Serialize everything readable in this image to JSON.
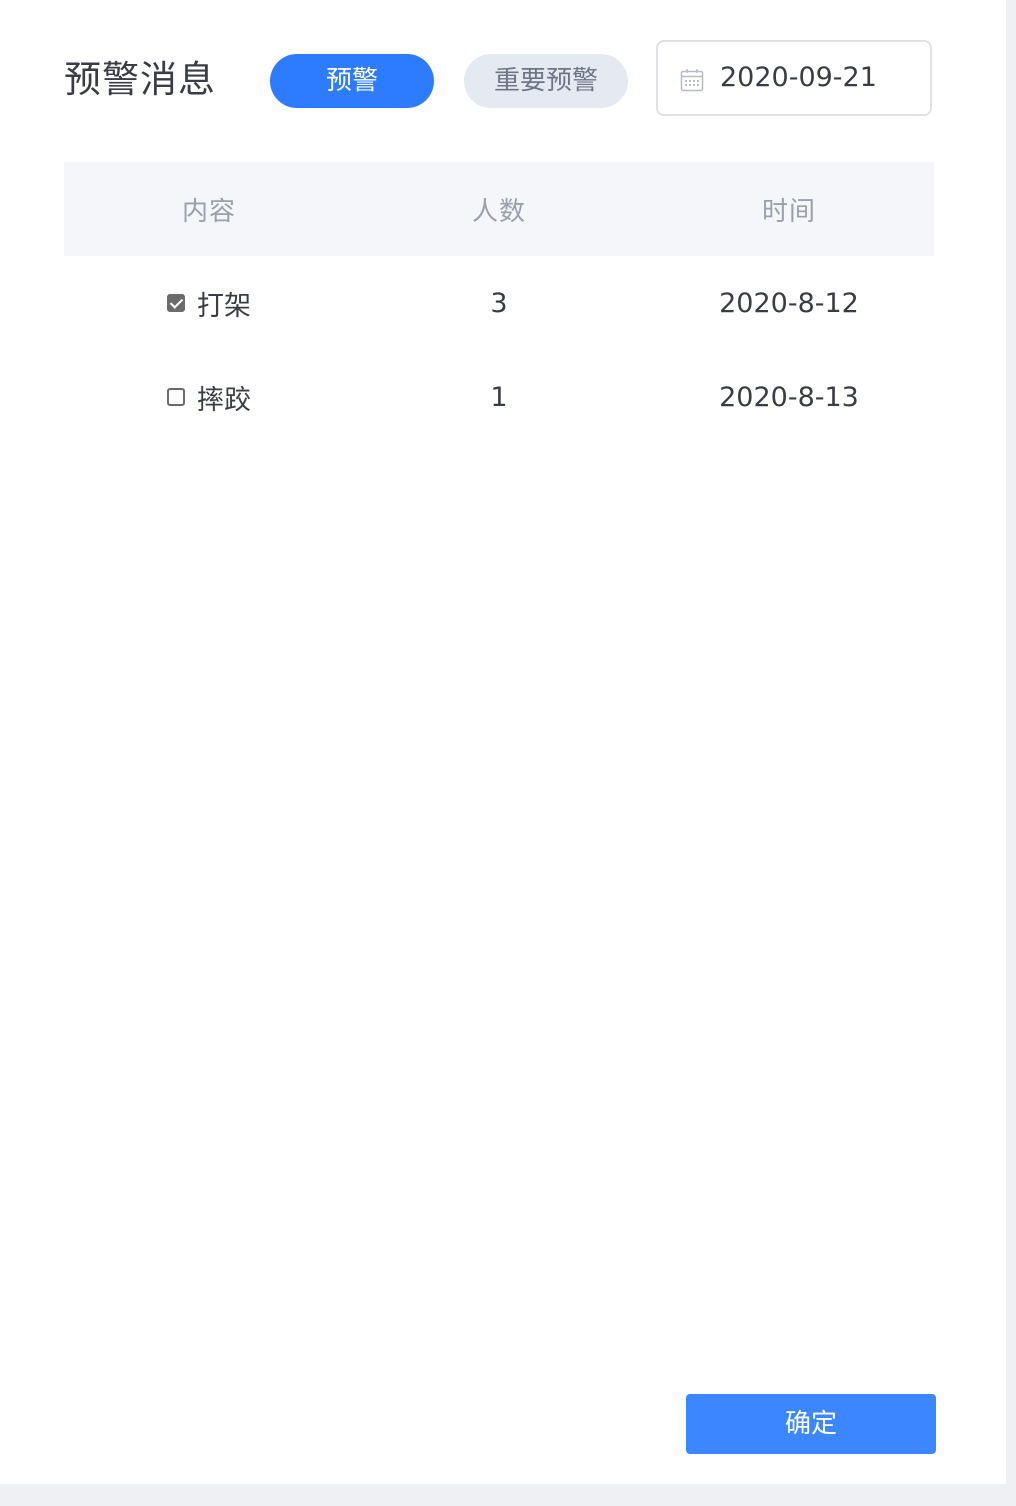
{
  "header": {
    "title": "预警消息",
    "tabs": [
      {
        "label": "预警",
        "active": true
      },
      {
        "label": "重要预警",
        "active": false
      }
    ],
    "date": {
      "value": "2020-09-21",
      "icon": "calendar-icon"
    }
  },
  "table": {
    "columns": [
      "内容",
      "人数",
      "时间"
    ],
    "rows": [
      {
        "checked": true,
        "content": "打架",
        "count": "3",
        "time": "2020-8-12"
      },
      {
        "checked": false,
        "content": "摔跤",
        "count": "1",
        "time": "2020-8-13"
      }
    ]
  },
  "footer": {
    "confirm_label": "确定"
  },
  "colors": {
    "primary": "#2d7bff",
    "button": "#3c86ff",
    "pill_inactive_bg": "#e5e9f1",
    "table_header_bg": "#f4f6f9",
    "page_bg": "#eef0f3"
  }
}
